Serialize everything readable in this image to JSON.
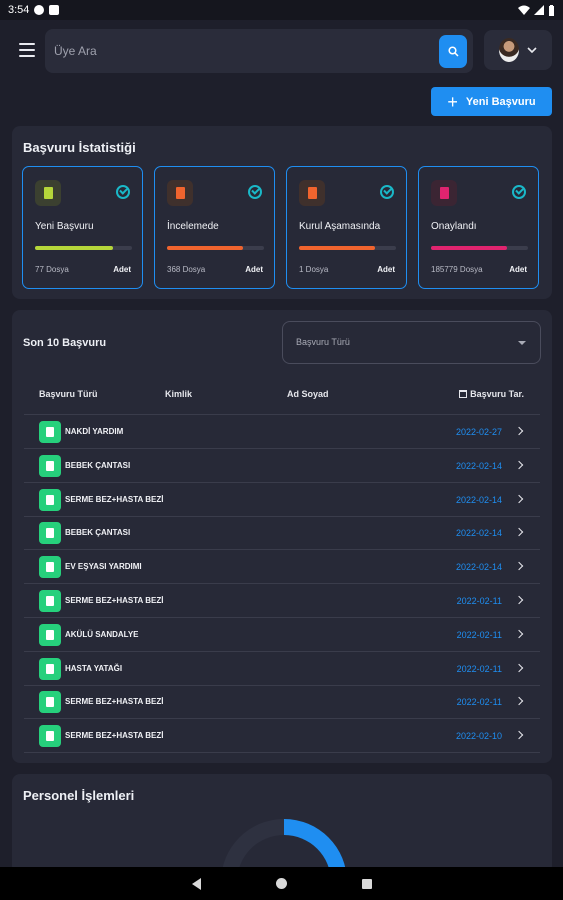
{
  "status_bar": {
    "time": "3:54"
  },
  "search": {
    "placeholder": "Üye Ara"
  },
  "actions": {
    "new_application": "Yeni Başvuru"
  },
  "stats": {
    "title": "Başvuru İstatistiği",
    "items": [
      {
        "label": "Yeni Başvuru",
        "count": "77 Dosya",
        "unit": "Adet",
        "color": "#b5d63a",
        "icon_bg": "#3b4030",
        "progress": 0.8
      },
      {
        "label": "İncelemede",
        "count": "368 Dosya",
        "unit": "Adet",
        "color": "#f0642e",
        "icon_bg": "#3f302c",
        "progress": 0.78
      },
      {
        "label": "Kurul Aşamasında",
        "count": "1 Dosya",
        "unit": "Adet",
        "color": "#f0642e",
        "icon_bg": "#3f302c",
        "progress": 0.78
      },
      {
        "label": "Onaylandı",
        "count": "185779 Dosya",
        "unit": "Adet",
        "color": "#e0246f",
        "icon_bg": "#3b2533",
        "progress": 0.78
      }
    ]
  },
  "recent": {
    "title": "Son 10 Başvuru",
    "filter_placeholder": "Başvuru Türü",
    "columns": [
      "Başvuru Türü",
      "Kimlik",
      "Ad Soyad",
      "Başvuru Tar."
    ],
    "rows": [
      {
        "type": "NAKDİ YARDIM",
        "date": "2022-02-27"
      },
      {
        "type": "BEBEK ÇANTASI",
        "date": "2022-02-14"
      },
      {
        "type": "SERME BEZ+HASTA BEZİ",
        "date": "2022-02-14"
      },
      {
        "type": "BEBEK ÇANTASI",
        "date": "2022-02-14"
      },
      {
        "type": "EV EŞYASI YARDIMI",
        "date": "2022-02-14"
      },
      {
        "type": "SERME BEZ+HASTA BEZİ",
        "date": "2022-02-11"
      },
      {
        "type": "AKÜLÜ SANDALYE",
        "date": "2022-02-11"
      },
      {
        "type": "HASTA YATAĞI",
        "date": "2022-02-11"
      },
      {
        "type": "SERME BEZ+HASTA BEZİ",
        "date": "2022-02-11"
      },
      {
        "type": "SERME BEZ+HASTA BEZİ",
        "date": "2022-02-10"
      }
    ]
  },
  "personel": {
    "title": "Personel İşlemleri"
  },
  "colors": {
    "accent": "#1f8ef1",
    "row_icon": "#26d07c",
    "check": "#1ab8c8",
    "background": "#1e1f2b",
    "card": "#272937"
  }
}
